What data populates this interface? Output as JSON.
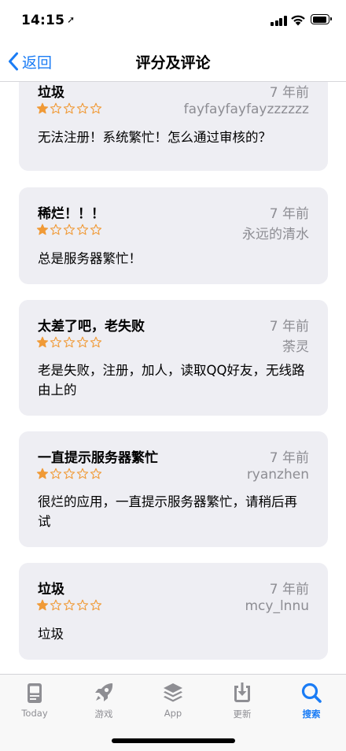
{
  "status": {
    "time": "14:15",
    "location_arrow": "➚"
  },
  "nav": {
    "back_label": "返回",
    "title": "评分及评论"
  },
  "reviews": [
    {
      "title": "垃圾",
      "date": "7 年前",
      "author": "fayfayfayfayzzzzzz",
      "rating": 1,
      "max_rating": 5,
      "body": "无法注册！系统繁忙！怎么通过审核的？"
    },
    {
      "title": "稀烂！！！",
      "date": "7 年前",
      "author": "永远的清水",
      "rating": 1,
      "max_rating": 5,
      "body": "总是服务器繁忙！"
    },
    {
      "title": "太差了吧，老失败",
      "date": "7 年前",
      "author": "荼灵",
      "rating": 1,
      "max_rating": 5,
      "body": "老是失败，注册，加人，读取QQ好友，无线路由上的"
    },
    {
      "title": "一直提示服务器繁忙",
      "date": "7 年前",
      "author": "ryanzhen",
      "rating": 1,
      "max_rating": 5,
      "body": "很烂的应用，一直提示服务器繁忙，请稍后再试"
    },
    {
      "title": "垃圾",
      "date": "7 年前",
      "author": "mcy_lnnu",
      "rating": 1,
      "max_rating": 5,
      "body": "垃圾"
    }
  ],
  "tabs": [
    {
      "label": "Today",
      "icon": "today-icon"
    },
    {
      "label": "游戏",
      "icon": "rocket-icon"
    },
    {
      "label": "App",
      "icon": "layers-icon"
    },
    {
      "label": "更新",
      "icon": "download-tray-icon"
    },
    {
      "label": "搜索",
      "icon": "search-icon",
      "active": true
    }
  ],
  "colors": {
    "accent": "#1a7cf5",
    "star": "#f09a37",
    "card": "#eeeef3",
    "secondary_text": "#8d8d93"
  }
}
